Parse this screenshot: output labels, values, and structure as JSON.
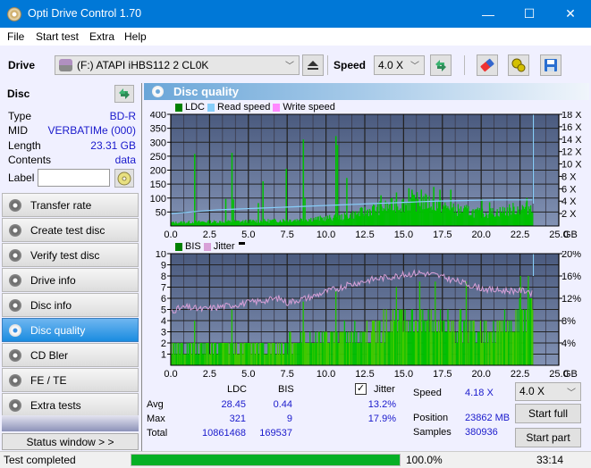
{
  "window": {
    "title": "Opti Drive Control 1.70",
    "minimize": "—",
    "maximize": "☐",
    "close": "✕"
  },
  "menu": [
    "File",
    "Start test",
    "Extra",
    "Help"
  ],
  "toolbar": {
    "drive_label": "Drive",
    "drive_value": "(F:)  ATAPI iHBS112  2 CL0K",
    "speed_label": "Speed",
    "speed_value": "4.0 X",
    "icons": [
      "drive-icon",
      "eject-icon",
      "refresh-icon",
      "eraser-icon",
      "settings-icon",
      "save-icon"
    ]
  },
  "disc": {
    "header": "Disc",
    "rows": [
      {
        "key": "Type",
        "value": "BD-R"
      },
      {
        "key": "MID",
        "value": "VERBATIMe (000)"
      },
      {
        "key": "Length",
        "value": "23.31 GB"
      },
      {
        "key": "Contents",
        "value": "data"
      }
    ],
    "label_key": "Label",
    "label_value": ""
  },
  "nav": [
    {
      "label": "Transfer rate",
      "active": false
    },
    {
      "label": "Create test disc",
      "active": false
    },
    {
      "label": "Verify test disc",
      "active": false
    },
    {
      "label": "Drive info",
      "active": false
    },
    {
      "label": "Disc info",
      "active": false
    },
    {
      "label": "Disc quality",
      "active": true
    },
    {
      "label": "CD Bler",
      "active": false
    },
    {
      "label": "FE / TE",
      "active": false
    },
    {
      "label": "Extra tests",
      "active": false
    }
  ],
  "status_window_label": "Status window > >",
  "panel_title": "Disc quality",
  "colors": {
    "ldc": "#00c000",
    "read_speed": "#87cefa",
    "write_speed": "#ff88ff",
    "bis": "#00c000",
    "jitter": "#d8a0d8",
    "plot_bg_top": "#4a5a7e",
    "plot_bg_bottom": "#8292b4",
    "accent": "#0078d7",
    "progress": "#06b025"
  },
  "chart_data": [
    {
      "type": "area",
      "title": "LDC / Read speed",
      "legend": [
        "LDC",
        "Read speed",
        "Write speed"
      ],
      "legend_position": "top-left",
      "x_ticks": [
        "0.0",
        "2.5",
        "5.0",
        "7.5",
        "10.0",
        "12.5",
        "15.0",
        "17.5",
        "20.0",
        "22.5",
        "25.0"
      ],
      "x_unit": "GB",
      "xlim": [
        0,
        25
      ],
      "y_ticks": [
        "50",
        "100",
        "150",
        "200",
        "250",
        "300",
        "350",
        "400"
      ],
      "ylim": [
        0,
        400
      ],
      "y2_ticks": [
        "2 X",
        "4 X",
        "6 X",
        "8 X",
        "10 X",
        "12 X",
        "14 X",
        "16 X",
        "18 X"
      ],
      "y2lim": [
        0,
        18
      ],
      "grid": true,
      "ldc_baseline": [
        [
          0,
          12
        ],
        [
          2,
          15
        ],
        [
          4,
          16
        ],
        [
          6,
          18
        ],
        [
          8,
          22
        ],
        [
          10,
          28
        ],
        [
          11,
          32
        ],
        [
          12,
          45
        ],
        [
          13,
          60
        ],
        [
          14,
          70
        ],
        [
          15,
          80
        ],
        [
          16,
          88
        ],
        [
          17,
          80
        ],
        [
          18,
          60
        ],
        [
          19,
          55
        ],
        [
          20,
          45
        ],
        [
          21,
          50
        ],
        [
          22,
          60
        ],
        [
          23,
          65
        ],
        [
          23.3,
          80
        ]
      ],
      "ldc_spikes": [
        [
          1.5,
          258
        ],
        [
          3.9,
          262
        ],
        [
          4.0,
          95
        ],
        [
          3.5,
          97
        ],
        [
          5.9,
          160
        ],
        [
          5.6,
          82
        ],
        [
          7.4,
          205
        ],
        [
          8.5,
          310
        ],
        [
          8.6,
          100
        ],
        [
          10.6,
          322
        ],
        [
          10.7,
          290
        ],
        [
          11.3,
          172
        ],
        [
          13.5,
          110
        ],
        [
          14.5,
          120
        ],
        [
          15.3,
          135
        ],
        [
          15.5,
          130
        ],
        [
          16.1,
          130
        ],
        [
          16.9,
          140
        ],
        [
          17.3,
          130
        ],
        [
          18.0,
          130
        ],
        [
          20.0,
          95
        ],
        [
          20.5,
          85
        ],
        [
          22.9,
          100
        ]
      ],
      "read_speed": [
        [
          0,
          2.0
        ],
        [
          1,
          2.2
        ],
        [
          2,
          2.4
        ],
        [
          3,
          2.6
        ],
        [
          4,
          2.7
        ],
        [
          5,
          2.8
        ],
        [
          6,
          2.9
        ],
        [
          7,
          3.0
        ],
        [
          8,
          3.1
        ],
        [
          9,
          3.2
        ],
        [
          10,
          3.3
        ],
        [
          11,
          3.4
        ],
        [
          12,
          3.5
        ],
        [
          13,
          3.6
        ],
        [
          14,
          3.7
        ],
        [
          15,
          3.8
        ],
        [
          16,
          3.9
        ],
        [
          17,
          4.0
        ],
        [
          18,
          4.05
        ],
        [
          19,
          4.1
        ],
        [
          20,
          4.15
        ],
        [
          21,
          4.2
        ],
        [
          22,
          4.2
        ],
        [
          23.3,
          4.2
        ]
      ]
    },
    {
      "type": "bar",
      "title": "BIS / Jitter",
      "legend": [
        "BIS",
        "Jitter"
      ],
      "legend_position": "top-left",
      "x_ticks": [
        "0.0",
        "2.5",
        "5.0",
        "7.5",
        "10.0",
        "12.5",
        "15.0",
        "17.5",
        "20.0",
        "22.5",
        "25.0"
      ],
      "x_unit": "GB",
      "xlim": [
        0,
        25
      ],
      "y_ticks": [
        "1",
        "2",
        "3",
        "4",
        "5",
        "6",
        "7",
        "8",
        "9",
        "10"
      ],
      "ylim": [
        0,
        10
      ],
      "y2_ticks": [
        "4%",
        "8%",
        "12%",
        "16%",
        "20%"
      ],
      "y2lim": [
        0,
        20
      ],
      "grid": true,
      "bis_level": [
        [
          0,
          2
        ],
        [
          2,
          2
        ],
        [
          5,
          2
        ],
        [
          7,
          2
        ],
        [
          8,
          3
        ],
        [
          10,
          3
        ],
        [
          12,
          3.5
        ],
        [
          13,
          4
        ],
        [
          15,
          5
        ],
        [
          17,
          5
        ],
        [
          19,
          4
        ],
        [
          20,
          4
        ],
        [
          22,
          4.5
        ],
        [
          23.3,
          7
        ]
      ],
      "bis_spikes": [
        [
          1.5,
          4
        ],
        [
          3.9,
          5
        ],
        [
          8.5,
          5.7
        ],
        [
          10.6,
          6.7
        ],
        [
          14.5,
          7
        ],
        [
          16.0,
          7.5
        ],
        [
          17.0,
          7.5
        ],
        [
          19.0,
          7.5
        ],
        [
          22.5,
          8
        ],
        [
          23.0,
          8
        ]
      ],
      "jitter": [
        [
          0,
          9.8
        ],
        [
          1,
          10.4
        ],
        [
          2,
          10.0
        ],
        [
          3,
          10.4
        ],
        [
          4,
          10.8
        ],
        [
          5,
          11.2
        ],
        [
          6,
          11.6
        ],
        [
          7,
          12.0
        ],
        [
          7.5,
          11.2
        ],
        [
          8,
          11.6
        ],
        [
          9,
          12.2
        ],
        [
          10,
          13.2
        ],
        [
          11,
          14.0
        ],
        [
          12,
          14.8
        ],
        [
          13,
          15.4
        ],
        [
          14,
          15.8
        ],
        [
          15,
          16.2
        ],
        [
          16,
          16.6
        ],
        [
          17,
          16.2
        ],
        [
          18,
          15.4
        ],
        [
          19,
          14.6
        ],
        [
          20,
          13.8
        ],
        [
          21,
          13.4
        ],
        [
          22,
          13.4
        ],
        [
          23,
          13.4
        ],
        [
          23.3,
          12.8
        ]
      ]
    }
  ],
  "stats": {
    "col_ldc": "LDC",
    "col_bis": "BIS",
    "jitter_label": "Jitter",
    "jitter_checked": true,
    "rows": [
      {
        "label": "Avg",
        "ldc": "28.45",
        "bis": "0.44",
        "jitter": "13.2%"
      },
      {
        "label": "Max",
        "ldc": "321",
        "bis": "9",
        "jitter": "17.9%"
      },
      {
        "label": "Total",
        "ldc": "10861468",
        "bis": "169537",
        "jitter": ""
      }
    ],
    "speed_label": "Speed",
    "speed_value": "4.18 X",
    "position_label": "Position",
    "position_value": "23862 MB",
    "samples_label": "Samples",
    "samples_value": "380936",
    "speed_select": "4.0 X",
    "start_full": "Start full",
    "start_part": "Start part"
  },
  "statusbar": {
    "text": "Test completed",
    "progress_percent": 100,
    "progress_label": "100.0%",
    "time": "33:14"
  }
}
